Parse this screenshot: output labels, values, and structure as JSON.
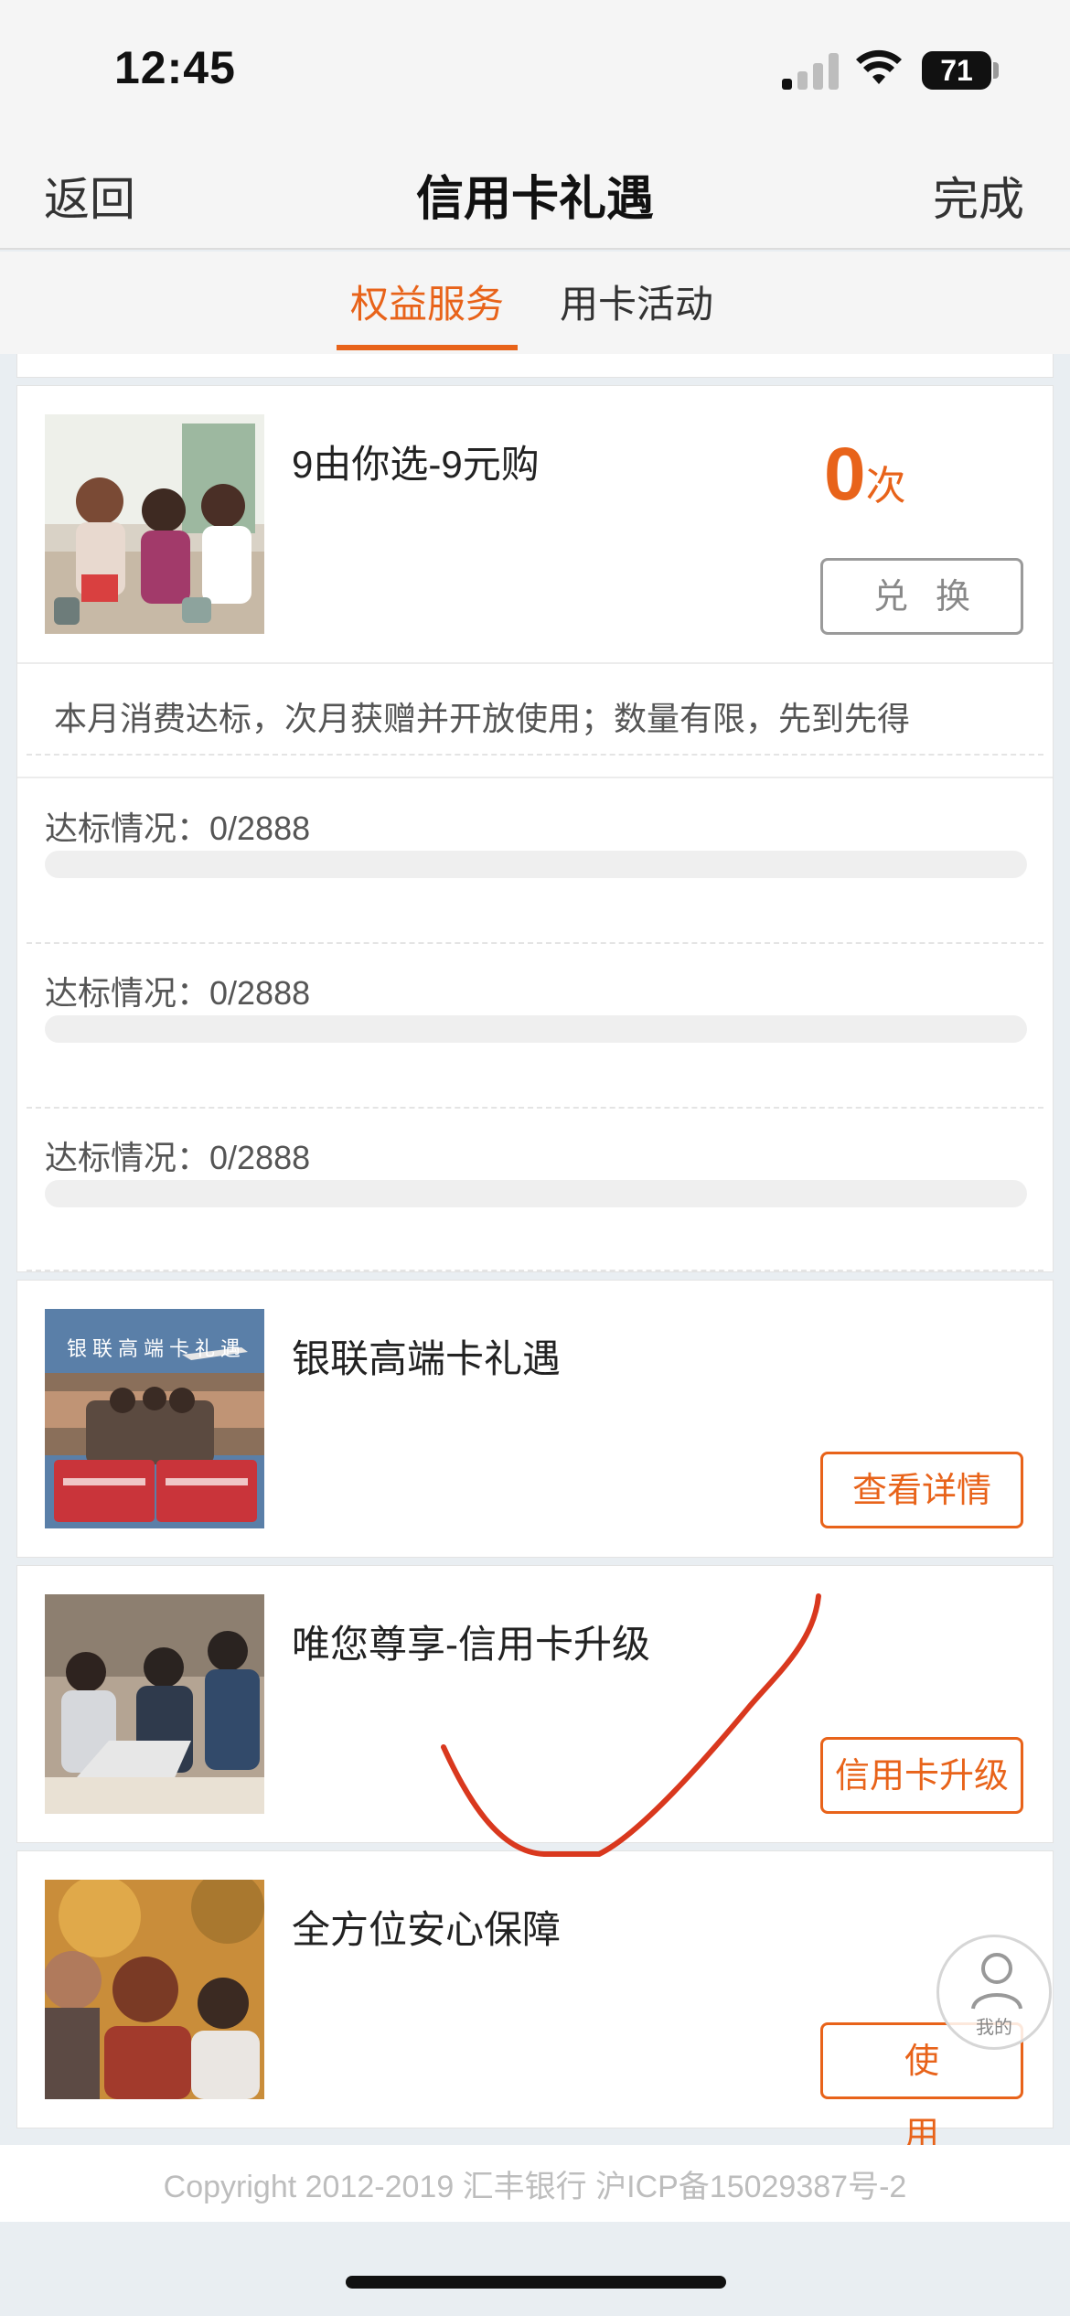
{
  "status_bar": {
    "time": "12:45",
    "battery": "71"
  },
  "nav": {
    "back_label": "返回",
    "title": "信用卡礼遇",
    "done_label": "完成"
  },
  "tabs": [
    {
      "label": "权益服务",
      "active": true
    },
    {
      "label": "用卡活动",
      "active": false
    }
  ],
  "benefit": {
    "title": "9由你选-9元购",
    "count": "0",
    "count_unit": "次",
    "button_label": "兑换",
    "note": "本月消费达标，次月获赠并开放使用；数量有限，先到先得",
    "progress": [
      {
        "label": "达标情况：0/2888",
        "fraction": 0
      },
      {
        "label": "达标情况：0/2888",
        "fraction": 0
      },
      {
        "label": "达标情况：0/2888",
        "fraction": 0
      }
    ]
  },
  "items": [
    {
      "title": "银联高端卡礼遇",
      "button_label": "查看详情",
      "image_caption": "银联高端卡礼遇"
    },
    {
      "title": "唯您尊享-信用卡升级",
      "button_label": "信用卡升级"
    },
    {
      "title": "全方位安心保障",
      "button_label": "使用"
    }
  ],
  "float_button": {
    "label": "我的"
  },
  "footer": {
    "copyright": "Copyright 2012-2019 汇丰银行 沪ICP备15029387号-2"
  },
  "colors": {
    "accent": "#e8631a",
    "annotation": "#d9381e"
  }
}
